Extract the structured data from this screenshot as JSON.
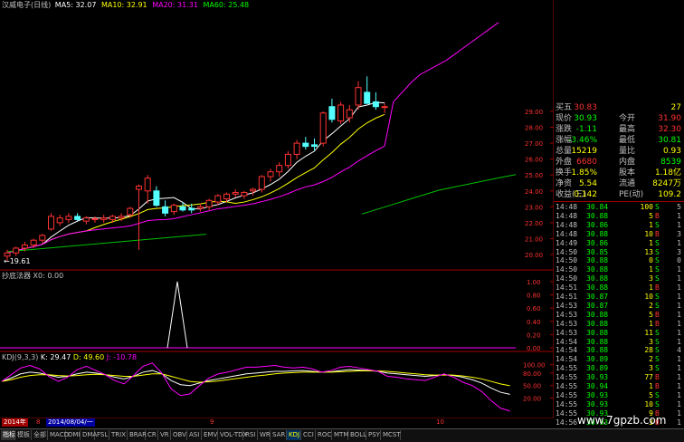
{
  "header": {
    "title": "汉威电子(日线)",
    "ma": [
      {
        "label": "MA5: 32.07",
        "color": "#ffffff"
      },
      {
        "label": "MA10: 32.91",
        "color": "#ffff00"
      },
      {
        "label": "MA20: 31.31",
        "color": "#ff00ff"
      },
      {
        "label": "MA60: 25.48",
        "color": "#00ff00"
      }
    ]
  },
  "colors": {
    "up": "#ff3232",
    "down": "#54ffff",
    "axis": "#a00000",
    "ma5": "#ffffff",
    "ma10": "#ffff00",
    "ma20": "#ff00ff",
    "ma60": "#00c000"
  },
  "price_axis": [
    "29.00",
    "28.00",
    "27.00",
    "26.00",
    "25.00",
    "24.00",
    "23.00",
    "22.00",
    "21.00",
    "20.00"
  ],
  "low_marker": "19.61",
  "indicator1": {
    "title": "抄底法器 X0: 0.00",
    "axis": [
      "1.00",
      "0.80",
      "0.60",
      "0.40",
      "0.20",
      "0.00"
    ]
  },
  "kdj": {
    "title": "KDJ(9,3,3)",
    "k": "K: 29.47",
    "d": "D: 49.60",
    "j": "J: -10.78",
    "axis": [
      "100.00",
      "80.00",
      "50.00",
      "20.00"
    ]
  },
  "chart_data": {
    "type": "candlestick",
    "candles": [
      {
        "o": 19.9,
        "h": 20.3,
        "l": 19.61,
        "c": 20.1
      },
      {
        "o": 20.1,
        "h": 20.5,
        "l": 19.9,
        "c": 20.4
      },
      {
        "o": 20.4,
        "h": 20.8,
        "l": 20.2,
        "c": 20.6
      },
      {
        "o": 20.6,
        "h": 21.0,
        "l": 20.4,
        "c": 20.9
      },
      {
        "o": 20.9,
        "h": 21.3,
        "l": 20.7,
        "c": 21.2
      },
      {
        "o": 21.6,
        "h": 22.6,
        "l": 21.5,
        "c": 22.4
      },
      {
        "o": 22.0,
        "h": 22.5,
        "l": 21.8,
        "c": 22.3
      },
      {
        "o": 22.2,
        "h": 22.6,
        "l": 22.0,
        "c": 22.4
      },
      {
        "o": 22.4,
        "h": 22.6,
        "l": 22.1,
        "c": 22.2
      },
      {
        "o": 22.1,
        "h": 22.4,
        "l": 21.9,
        "c": 22.3
      },
      {
        "o": 22.2,
        "h": 22.4,
        "l": 22.0,
        "c": 22.25
      },
      {
        "o": 22.2,
        "h": 22.5,
        "l": 22.0,
        "c": 22.3
      },
      {
        "o": 22.2,
        "h": 22.5,
        "l": 22.0,
        "c": 22.4
      },
      {
        "o": 22.3,
        "h": 22.6,
        "l": 22.1,
        "c": 22.4
      },
      {
        "o": 22.5,
        "h": 23.0,
        "l": 22.3,
        "c": 22.9
      },
      {
        "o": 24.1,
        "h": 24.4,
        "l": 20.3,
        "c": 24.3
      },
      {
        "o": 24.0,
        "h": 25.0,
        "l": 23.2,
        "c": 24.8
      },
      {
        "o": 24.0,
        "h": 24.3,
        "l": 23.0,
        "c": 23.1
      },
      {
        "o": 23.0,
        "h": 23.4,
        "l": 22.4,
        "c": 22.6
      },
      {
        "o": 22.7,
        "h": 23.2,
        "l": 22.5,
        "c": 23.1
      },
      {
        "o": 23.0,
        "h": 23.3,
        "l": 22.7,
        "c": 22.8
      },
      {
        "o": 22.9,
        "h": 23.2,
        "l": 22.6,
        "c": 22.8
      },
      {
        "o": 22.9,
        "h": 23.2,
        "l": 22.7,
        "c": 23.0
      },
      {
        "o": 23.0,
        "h": 23.5,
        "l": 22.8,
        "c": 23.4
      },
      {
        "o": 23.3,
        "h": 23.8,
        "l": 23.1,
        "c": 23.7
      },
      {
        "o": 23.5,
        "h": 23.9,
        "l": 23.3,
        "c": 23.8
      },
      {
        "o": 23.8,
        "h": 24.1,
        "l": 23.6,
        "c": 23.9
      },
      {
        "o": 23.7,
        "h": 24.0,
        "l": 23.5,
        "c": 23.9
      },
      {
        "o": 24.0,
        "h": 24.2,
        "l": 23.7,
        "c": 24.1
      },
      {
        "o": 24.1,
        "h": 25.0,
        "l": 23.9,
        "c": 24.9
      },
      {
        "o": 24.9,
        "h": 25.4,
        "l": 24.6,
        "c": 25.2
      },
      {
        "o": 25.2,
        "h": 25.8,
        "l": 24.9,
        "c": 25.6
      },
      {
        "o": 25.6,
        "h": 26.5,
        "l": 25.4,
        "c": 26.3
      },
      {
        "o": 26.3,
        "h": 27.2,
        "l": 26.0,
        "c": 27.0
      },
      {
        "o": 27.0,
        "h": 27.4,
        "l": 26.6,
        "c": 26.8
      },
      {
        "o": 26.9,
        "h": 27.3,
        "l": 26.5,
        "c": 26.8
      },
      {
        "o": 27.0,
        "h": 29.0,
        "l": 26.8,
        "c": 28.9
      },
      {
        "o": 29.3,
        "h": 29.8,
        "l": 28.3,
        "c": 28.5
      },
      {
        "o": 28.4,
        "h": 29.6,
        "l": 28.2,
        "c": 29.4
      },
      {
        "o": 28.6,
        "h": 29.4,
        "l": 28.3,
        "c": 29.1
      },
      {
        "o": 29.4,
        "h": 30.9,
        "l": 29.1,
        "c": 30.5
      },
      {
        "o": 30.2,
        "h": 31.2,
        "l": 29.9,
        "c": 29.5
      },
      {
        "o": 29.6,
        "h": 30.2,
        "l": 29.1,
        "c": 29.3
      },
      {
        "o": 29.3,
        "h": 29.5,
        "l": 28.9,
        "c": 29.3
      }
    ]
  },
  "panel": {
    "rows": [
      {
        "l": "买五",
        "v": "30.83",
        "v2": "",
        "r": "27",
        "vc": "#ff3232",
        "rc": "#ffff00"
      },
      {
        "l": "现价",
        "v": "30.93",
        "v2": "今开",
        "r": "31.90",
        "vc": "#00ff00",
        "rc": "#ff3232"
      },
      {
        "l": "涨跌",
        "v": "-1.11",
        "v2": "最高",
        "r": "32.30",
        "vc": "#00ff00",
        "rc": "#ff3232"
      },
      {
        "l": "涨幅",
        "v": "-3.46%",
        "v2": "最低",
        "r": "30.81",
        "vc": "#00ff00",
        "rc": "#00ff00"
      },
      {
        "l": "总量",
        "v": "15219",
        "v2": "量比",
        "r": "0.93",
        "vc": "#ffff00",
        "rc": "#ffff00"
      },
      {
        "l": "外盘",
        "v": "6680",
        "v2": "内盘",
        "r": "8539",
        "vc": "#ff3232",
        "rc": "#00ff00"
      },
      {
        "l": "换手",
        "v": "1.85%",
        "v2": "股本",
        "r": "1.18亿",
        "vc": "#ffff00",
        "rc": "#ffff00"
      },
      {
        "l": "净资",
        "v": "5.54",
        "v2": "流通",
        "r": "8247万",
        "vc": "#ffff00",
        "rc": "#ffff00"
      },
      {
        "l": "收益(三)",
        "v": "0.142",
        "v2": "PE(动)",
        "r": "109.2",
        "vc": "#ffff00",
        "rc": "#ffff00"
      }
    ],
    "ticks": [
      {
        "t": "14:48",
        "p": "30.84",
        "q": "100",
        "s": "S",
        "n": "5",
        "pc": "#00ff00"
      },
      {
        "t": "14:48",
        "p": "30.88",
        "q": "5",
        "s": "B",
        "n": "1",
        "pc": "#00ff00"
      },
      {
        "t": "14:48",
        "p": "30.86",
        "q": "1",
        "s": "S",
        "n": "1",
        "pc": "#00ff00"
      },
      {
        "t": "14:48",
        "p": "30.88",
        "q": "10",
        "s": "B",
        "n": "3",
        "pc": "#00ff00"
      },
      {
        "t": "14:49",
        "p": "30.86",
        "q": "1",
        "s": "S",
        "n": "1",
        "pc": "#00ff00"
      },
      {
        "t": "14:50",
        "p": "30.85",
        "q": "13",
        "s": "S",
        "n": "3",
        "pc": "#00ff00"
      },
      {
        "t": "14:50",
        "p": "30.88",
        "q": "0",
        "s": "S",
        "n": "0",
        "pc": "#00ff00"
      },
      {
        "t": "14:50",
        "p": "30.88",
        "q": "1",
        "s": "S",
        "n": "1",
        "pc": "#00ff00"
      },
      {
        "t": "14:50",
        "p": "30.88",
        "q": "3",
        "s": "S",
        "n": "1",
        "pc": "#00ff00"
      },
      {
        "t": "14:51",
        "p": "30.88",
        "q": "1",
        "s": "B",
        "n": "1",
        "pc": "#00ff00"
      },
      {
        "t": "14:51",
        "p": "30.87",
        "q": "10",
        "s": "S",
        "n": "1",
        "pc": "#00ff00"
      },
      {
        "t": "14:53",
        "p": "30.87",
        "q": "2",
        "s": "S",
        "n": "1",
        "pc": "#00ff00"
      },
      {
        "t": "14:53",
        "p": "30.88",
        "q": "5",
        "s": "B",
        "n": "1",
        "pc": "#00ff00"
      },
      {
        "t": "14:53",
        "p": "30.88",
        "q": "1",
        "s": "B",
        "n": "1",
        "pc": "#00ff00"
      },
      {
        "t": "14:53",
        "p": "30.88",
        "q": "11",
        "s": "S",
        "n": "1",
        "pc": "#00ff00"
      },
      {
        "t": "14:54",
        "p": "30.88",
        "q": "3",
        "s": "S",
        "n": "1",
        "pc": "#00ff00"
      },
      {
        "t": "14:54",
        "p": "30.88",
        "q": "28",
        "s": "S",
        "n": "4",
        "pc": "#00ff00"
      },
      {
        "t": "14:54",
        "p": "30.89",
        "q": "2",
        "s": "S",
        "n": "1",
        "pc": "#00ff00"
      },
      {
        "t": "14:55",
        "p": "30.89",
        "q": "3",
        "s": "S",
        "n": "1",
        "pc": "#00ff00"
      },
      {
        "t": "14:55",
        "p": "30.93",
        "q": "77",
        "s": "B",
        "n": "1",
        "pc": "#00ff00"
      },
      {
        "t": "14:55",
        "p": "30.94",
        "q": "1",
        "s": "B",
        "n": "1",
        "pc": "#00ff00"
      },
      {
        "t": "14:55",
        "p": "30.93",
        "q": "5",
        "s": "S",
        "n": "1",
        "pc": "#00ff00"
      },
      {
        "t": "14:55",
        "p": "30.93",
        "q": "10",
        "s": "S",
        "n": "1",
        "pc": "#00ff00"
      },
      {
        "t": "14:55",
        "p": "30.93",
        "q": "9",
        "s": "B",
        "n": "1",
        "pc": "#00ff00"
      },
      {
        "t": "14:56",
        "p": "30.93",
        "q": "3",
        "s": "B",
        "n": "1",
        "pc": "#00ff00"
      }
    ]
  },
  "datebar": {
    "year": "2014年",
    "mark": "8",
    "date": "2014/08/04/一",
    "m9": "9",
    "m10": "10"
  },
  "site": "www.7gpzb.com",
  "tabs": [
    "指标",
    "模板",
    "全部",
    "MACD",
    "DMI",
    "DMA",
    "FSL",
    "TRIX",
    "BRAR",
    "CR",
    "VR",
    "OBV",
    "ASI",
    "EMV",
    "VOL-TDX",
    "RSI",
    "WR",
    "SAR",
    "KDJ",
    "CCI",
    "ROC",
    "MTM",
    "BOLL",
    "PSY",
    "MCST"
  ]
}
